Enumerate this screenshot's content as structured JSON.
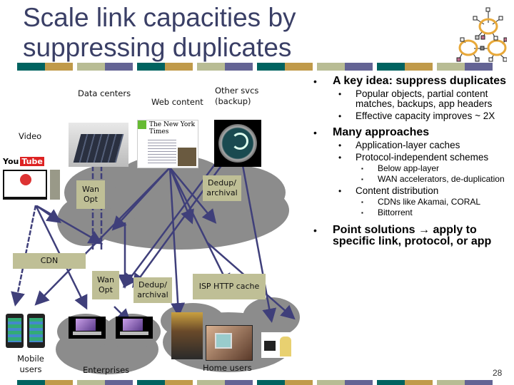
{
  "slide": {
    "title": "Scale link capacities by suppressing duplicates",
    "page_number": "28",
    "stripe_colors": [
      "#006360",
      "#c09a4a",
      "#b8bc94",
      "#646494"
    ],
    "logo_icon": "network-rings-icon"
  },
  "diagram": {
    "labels": {
      "video": "Video",
      "data_centers": "Data centers",
      "web_content": "Web content",
      "other_svcs": "Other svcs (backup)",
      "mobile_users": "Mobile users",
      "enterprises": "Enterprises",
      "home_users": "Home users"
    },
    "boxes": {
      "wan_opt_top": "Wan Opt",
      "dedup_top": "Dedup/ archival",
      "cdn": "CDN",
      "wan_opt_bottom": "Wan Opt",
      "dedup_bottom": "Dedup/ archival",
      "isp_cache": "ISP HTTP cache"
    },
    "images": {
      "youtube": "youtube-video-image",
      "datacenter": "datacenter-racks-image",
      "nytimes": "new-york-times-webpage-image",
      "timemachine": "backup-clock-icon",
      "phone": "smartphone-image",
      "laptop": "laptop-image",
      "home": "home-user-photo"
    },
    "colors": {
      "cloud": "#8c8c8c",
      "arrow": "#3f3f7a",
      "box": "#bfbf96"
    }
  },
  "bullets": [
    {
      "level": 1,
      "text": "A key idea: suppress duplicates"
    },
    {
      "level": 2,
      "text": "Popular objects, partial content matches, backups, app headers"
    },
    {
      "level": 2,
      "text": "Effective capacity improves ~ 2X"
    },
    {
      "level": 1,
      "text": "Many approaches"
    },
    {
      "level": 2,
      "text": "Application-layer caches"
    },
    {
      "level": 2,
      "text": "Protocol-independent schemes"
    },
    {
      "level": 3,
      "text": "Below app-layer"
    },
    {
      "level": 3,
      "text": "WAN accelerators, de-duplication"
    },
    {
      "level": 2,
      "text": "Content distribution"
    },
    {
      "level": 3,
      "text": "CDNs like Akamai, CORAL"
    },
    {
      "level": 3,
      "text": "Bittorrent"
    },
    {
      "level": 1,
      "text": "Point solutions → apply to specific link, protocol, or app"
    }
  ]
}
